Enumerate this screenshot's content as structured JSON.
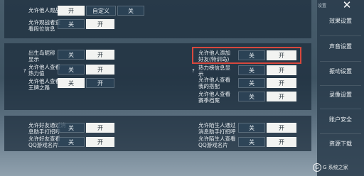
{
  "panel1": {
    "row1": {
      "label": "允许他人观战",
      "btn_on": "开",
      "btn_custom": "自定义",
      "btn_off": "关"
    },
    "row2": {
      "label": "允许观战者查\n看段位信息",
      "btn_off": "关",
      "btn_on": "开"
    }
  },
  "panel2": {
    "left": [
      {
        "label": "出生岛昵称\n显示",
        "btn_off": "关",
        "btn_on": "开"
      },
      {
        "label": "允许他人查看\n热力值",
        "btn_off": "关",
        "btn_on": "开"
      },
      {
        "label": "允许他人查看\n王牌之路",
        "btn_off": "关",
        "btn_on": "开"
      }
    ],
    "right": [
      {
        "label": "允许他人添加\n好友(特训岛)",
        "btn_off": "关",
        "btn_on": "开"
      },
      {
        "label": "热力榜信息显\n示",
        "btn_off": "关",
        "btn_on": "开"
      },
      {
        "label": "允许他人查看\n我的搭配",
        "btn_off": "关",
        "btn_on": "开"
      },
      {
        "label": "允许他人查看\n赛季档案",
        "btn_off": "关",
        "btn_on": "开"
      }
    ],
    "question_mark": "?"
  },
  "panel3": {
    "left": [
      {
        "label": "允许好友通过消\n息助手打招呼",
        "btn_off": "关",
        "btn_on": "开"
      },
      {
        "label": "允许好友查看\nQQ游戏名片",
        "btn_off": "关",
        "btn_on": "开"
      }
    ],
    "right": [
      {
        "label": "允许陌生人通过\n消息助手打招呼",
        "btn_off": "关",
        "btn_on": "开"
      },
      {
        "label": "允许陌生人查看\nQQ游戏名片",
        "btn_off": "关",
        "btn_on": "开"
      }
    ]
  },
  "sidebar": {
    "top_label": "设置",
    "items": [
      "效果设置",
      "声音设置",
      "振动设置",
      "录像设置",
      "账户安全",
      "资源下载"
    ]
  },
  "watermark": {
    "text": "G 系统之家"
  },
  "colors": {
    "highlight": "#d8483d",
    "on_button": "#f2f3f1"
  }
}
